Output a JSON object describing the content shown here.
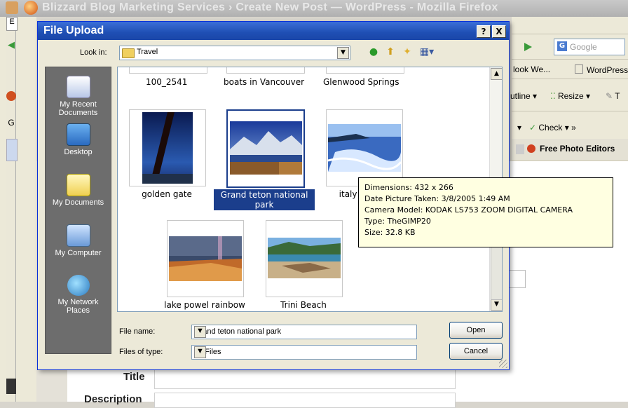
{
  "browser": {
    "title": "Blizzard Blog Marketing Services › Create New Post — WordPress - Mozilla Firefox",
    "search_placeholder": "Google",
    "bookmarks": [
      "look We...",
      "WordPress"
    ],
    "toolbar1": [
      "utline ▾",
      "Resize ▾",
      "T"
    ],
    "toolbar2": [
      "Check ▾ »"
    ],
    "tab_label": "Free Photo Editors"
  },
  "form": {
    "title_label": "Title",
    "description_label": "Description"
  },
  "dialog": {
    "title": "File Upload",
    "help_button": "?",
    "close_button": "X",
    "look_in_label": "Look in:",
    "look_in_value": "Travel",
    "places": [
      {
        "label": "My Recent Documents",
        "icon": "recent-documents-icon"
      },
      {
        "label": "Desktop",
        "icon": "desktop-icon"
      },
      {
        "label": "My Documents",
        "icon": "my-documents-icon"
      },
      {
        "label": "My Computer",
        "icon": "my-computer-icon"
      },
      {
        "label": "My Network Places",
        "icon": "network-places-icon"
      }
    ],
    "top_row": [
      "100_2541",
      "boats in Vancouver",
      "Glenwood Springs"
    ],
    "files": [
      {
        "name": "golden gate"
      },
      {
        "name": "Grand teton national park",
        "selected": true
      },
      {
        "name": "italy m"
      },
      {
        "name": "lake powel rainbow"
      },
      {
        "name": "Trini Beach"
      }
    ],
    "tooltip": {
      "dimensions": "Dimensions: 432 x 266",
      "date": "Date Picture Taken: 3/8/2005 1:49 AM",
      "camera": "Camera Model: KODAK LS753 ZOOM DIGITAL CAMERA",
      "type": "Type: TheGIMP20",
      "size": "Size: 32.8 KB"
    },
    "file_name_label": "File name:",
    "file_name_value": "Grand teton national park",
    "files_of_type_label": "Files of type:",
    "files_of_type_value": "All Files",
    "open_button": "Open",
    "cancel_button": "Cancel"
  }
}
